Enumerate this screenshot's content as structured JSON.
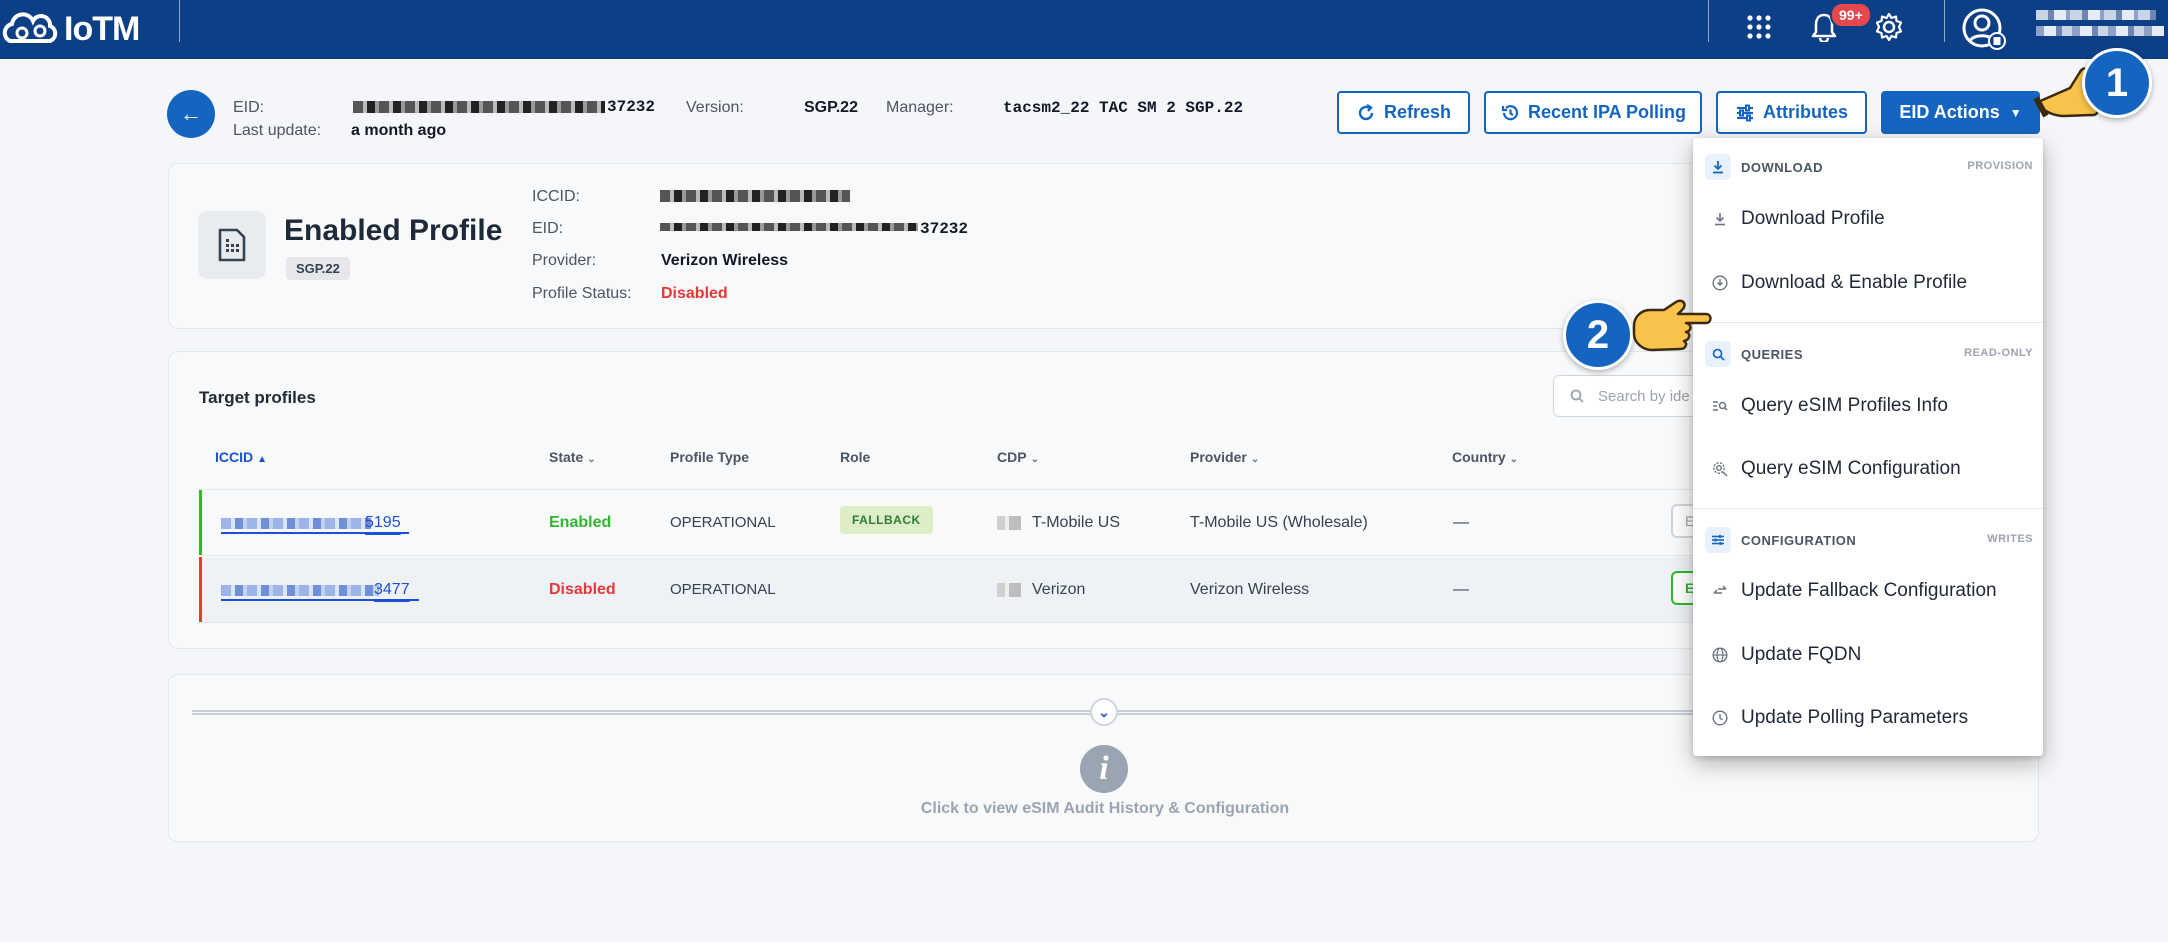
{
  "app": {
    "logo_text": "IoTM",
    "notification_count": "99+"
  },
  "header": {
    "eid_label": "EID:",
    "eid_value_suffix": "37232",
    "last_update_label": "Last update:",
    "last_update_value": "a month ago",
    "version_label": "Version:",
    "version_value": "SGP.22",
    "manager_label": "Manager:",
    "manager_value": "tacsm2_22 TAC SM 2 SGP.22"
  },
  "toolbar": {
    "refresh_label": "Refresh",
    "ipa_polling_label": "Recent IPA Polling",
    "attributes_label": "Attributes",
    "eid_actions_label": "EID Actions"
  },
  "enabled_profile": {
    "title": "Enabled Profile",
    "spec_badge": "SGP.22",
    "iccid_label": "ICCID:",
    "eid_label": "EID:",
    "eid_suffix": "37232",
    "provider_label": "Provider:",
    "provider_value": "Verizon Wireless",
    "status_label": "Profile Status:",
    "status_value": "Disabled"
  },
  "target_profiles": {
    "title": "Target profiles",
    "search_placeholder": "Search by ide",
    "columns": {
      "iccid": "ICCID",
      "state": "State",
      "profile_type": "Profile Type",
      "role": "Role",
      "cdp": "CDP",
      "provider": "Provider",
      "country": "Country"
    },
    "rows": [
      {
        "iccid_suffix": "5195",
        "state": "Enabled",
        "profile_type": "OPERATIONAL",
        "role": "FALLBACK",
        "cdp": "T-Mobile US",
        "provider": "T-Mobile US (Wholesale)",
        "country": "—",
        "action": "E"
      },
      {
        "iccid_suffix": "3477",
        "state": "Disabled",
        "profile_type": "OPERATIONAL",
        "role": "",
        "cdp": "Verizon",
        "provider": "Verizon Wireless",
        "country": "—",
        "action": "E"
      }
    ]
  },
  "history": {
    "label": "Click to view eSIM Audit History & Configuration"
  },
  "menu": {
    "download": {
      "title": "DOWNLOAD",
      "tag": "PROVISION",
      "items": [
        "Download Profile",
        "Download & Enable Profile"
      ]
    },
    "queries": {
      "title": "QUERIES",
      "tag": "READ-ONLY",
      "items": [
        "Query eSIM Profiles Info",
        "Query eSIM Configuration"
      ]
    },
    "configuration": {
      "title": "CONFIGURATION",
      "tag": "WRITES",
      "items": [
        "Update Fallback Configuration",
        "Update FQDN",
        "Update Polling Parameters"
      ]
    }
  },
  "steps": {
    "one": "1",
    "two": "2"
  },
  "colors": {
    "brand": "#0d3f87",
    "primary": "#1565c0",
    "enabled": "#2eb82e",
    "disabled": "#e53935"
  }
}
